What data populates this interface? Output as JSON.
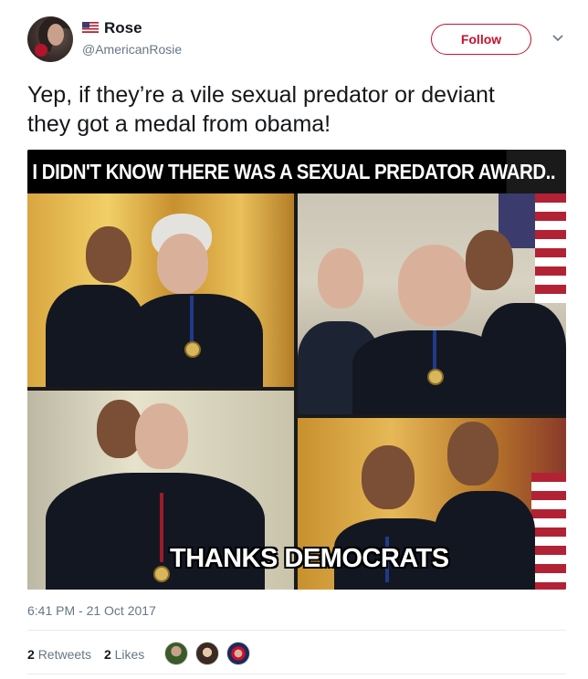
{
  "user": {
    "display_name": "Rose",
    "handle": "@AmericanRosie",
    "avatar_icon": "user-avatar",
    "flag_icon": "us-flag-icon"
  },
  "header": {
    "follow_label": "Follow",
    "menu_icon": "chevron-down-icon"
  },
  "tweet": {
    "text": "Yep, if they’re a vile sexual predator or deviant they got a medal from obama!",
    "timestamp": "6:41 PM - 21 Oct 2017"
  },
  "media": {
    "caption_top": "I DIDN'T KNOW THERE WAS A SEXUAL PREDATOR AWARD..",
    "caption_bottom": "THANKS DEMOCRATS"
  },
  "stats": {
    "retweets_count": "2",
    "retweets_label": "Retweets",
    "likes_count": "2",
    "likes_label": "Likes"
  },
  "colors": {
    "accent": "#c8102e",
    "text": "#14171a",
    "muted": "#657786"
  }
}
